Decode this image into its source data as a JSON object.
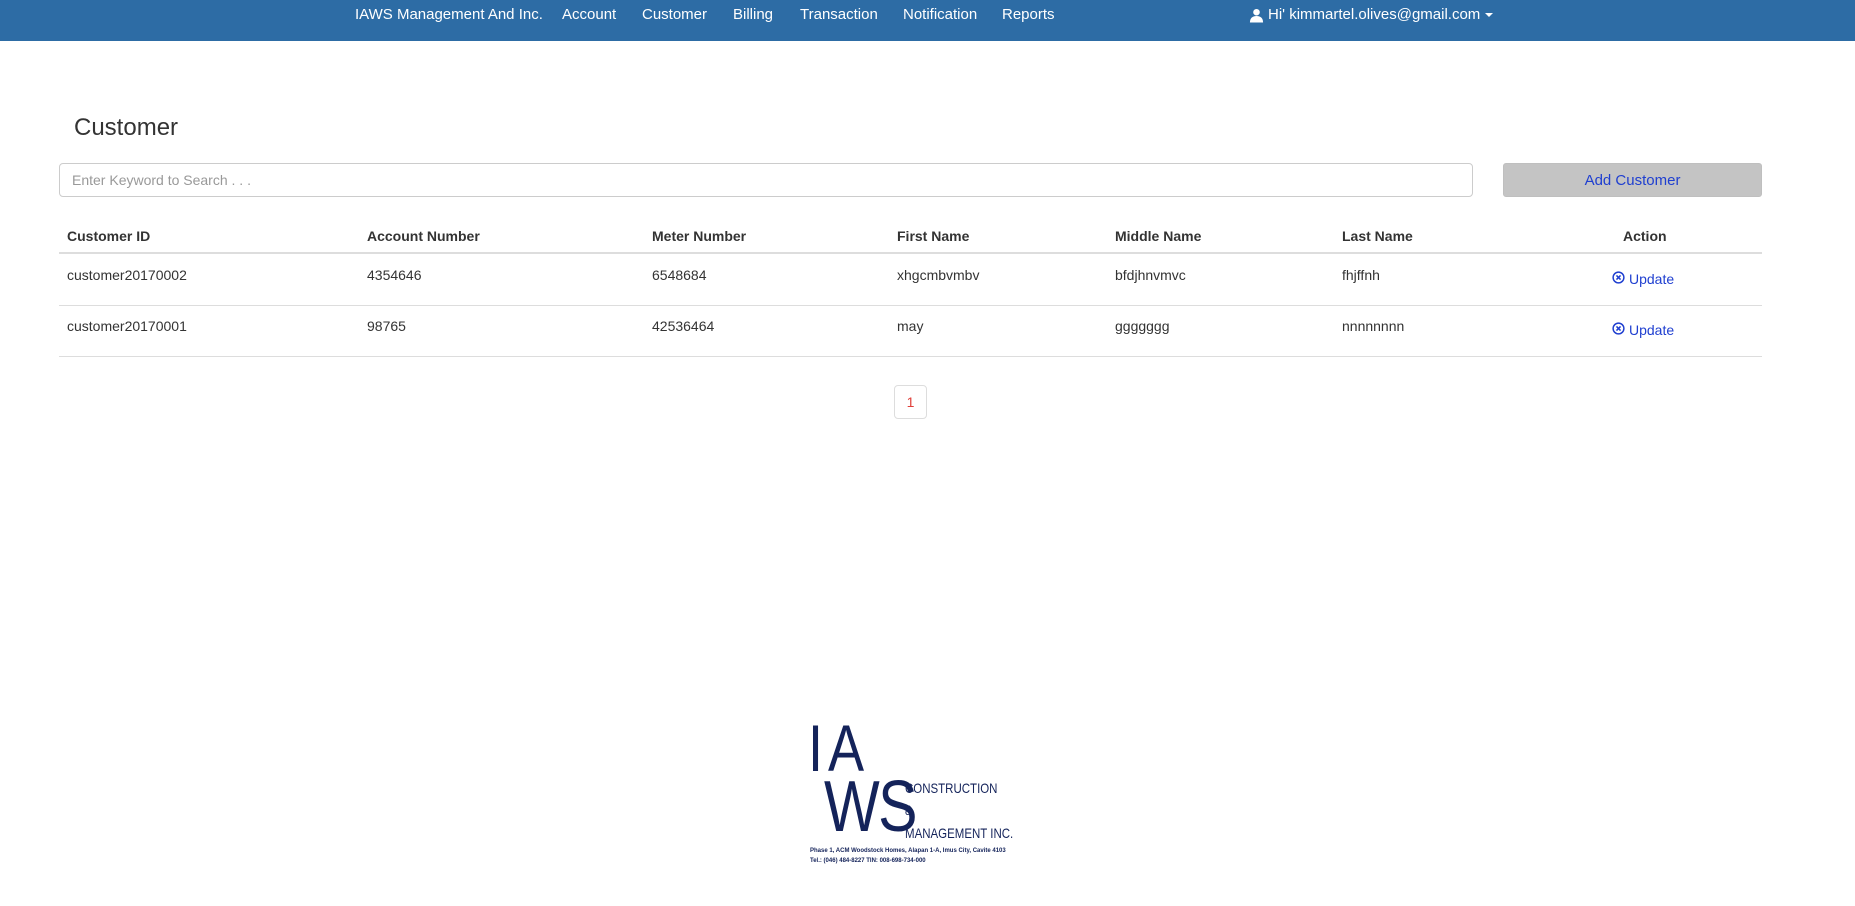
{
  "nav": {
    "brand": "IAWS Management And Inc.",
    "items": [
      {
        "label": "Account"
      },
      {
        "label": "Customer"
      },
      {
        "label": "Billing"
      },
      {
        "label": "Transaction"
      },
      {
        "label": "Notification"
      },
      {
        "label": "Reports"
      }
    ],
    "user_greeting": "Hi' kimmartel.olives@gmail.com",
    "user_icon": "user-icon",
    "bar_color": "#2d6ca5"
  },
  "page": {
    "title": "Customer"
  },
  "search": {
    "placeholder": "Enter Keyword to Search . . .",
    "value": ""
  },
  "toolbar": {
    "add_label": "Add Customer"
  },
  "table": {
    "columns": [
      "Customer ID",
      "Account Number",
      "Meter Number",
      "First Name",
      "Middle Name",
      "Last Name",
      "Action"
    ],
    "rows": [
      {
        "customer_id": "customer20170002",
        "account_number": "4354646",
        "meter_number": "6548684",
        "first_name": "xhgcmbvmbv",
        "middle_name": "bfdjhnvmvc",
        "last_name": "fhjffnh",
        "action": "Update"
      },
      {
        "customer_id": "customer20170001",
        "account_number": "98765",
        "meter_number": "42536464",
        "first_name": "may",
        "middle_name": "ggggggg",
        "last_name": "nnnnnnnn",
        "action": "Update"
      }
    ],
    "action_icon": "circle-x-icon"
  },
  "pagination": {
    "pages": [
      "1"
    ],
    "current": "1"
  },
  "footer": {
    "logo_text_1": "IA",
    "logo_text_2": "WS",
    "logo_line_1": "CONSTRUCTION",
    "logo_line_2": "&",
    "logo_line_3": "MANAGEMENT INC.",
    "address": "Phase 1, ACM Woodstock Homes, Alapan 1-A, Imus City, Cavite 4103",
    "tel": "Tel.: (046) 484-8227            TIN: 008-698-734-000"
  }
}
